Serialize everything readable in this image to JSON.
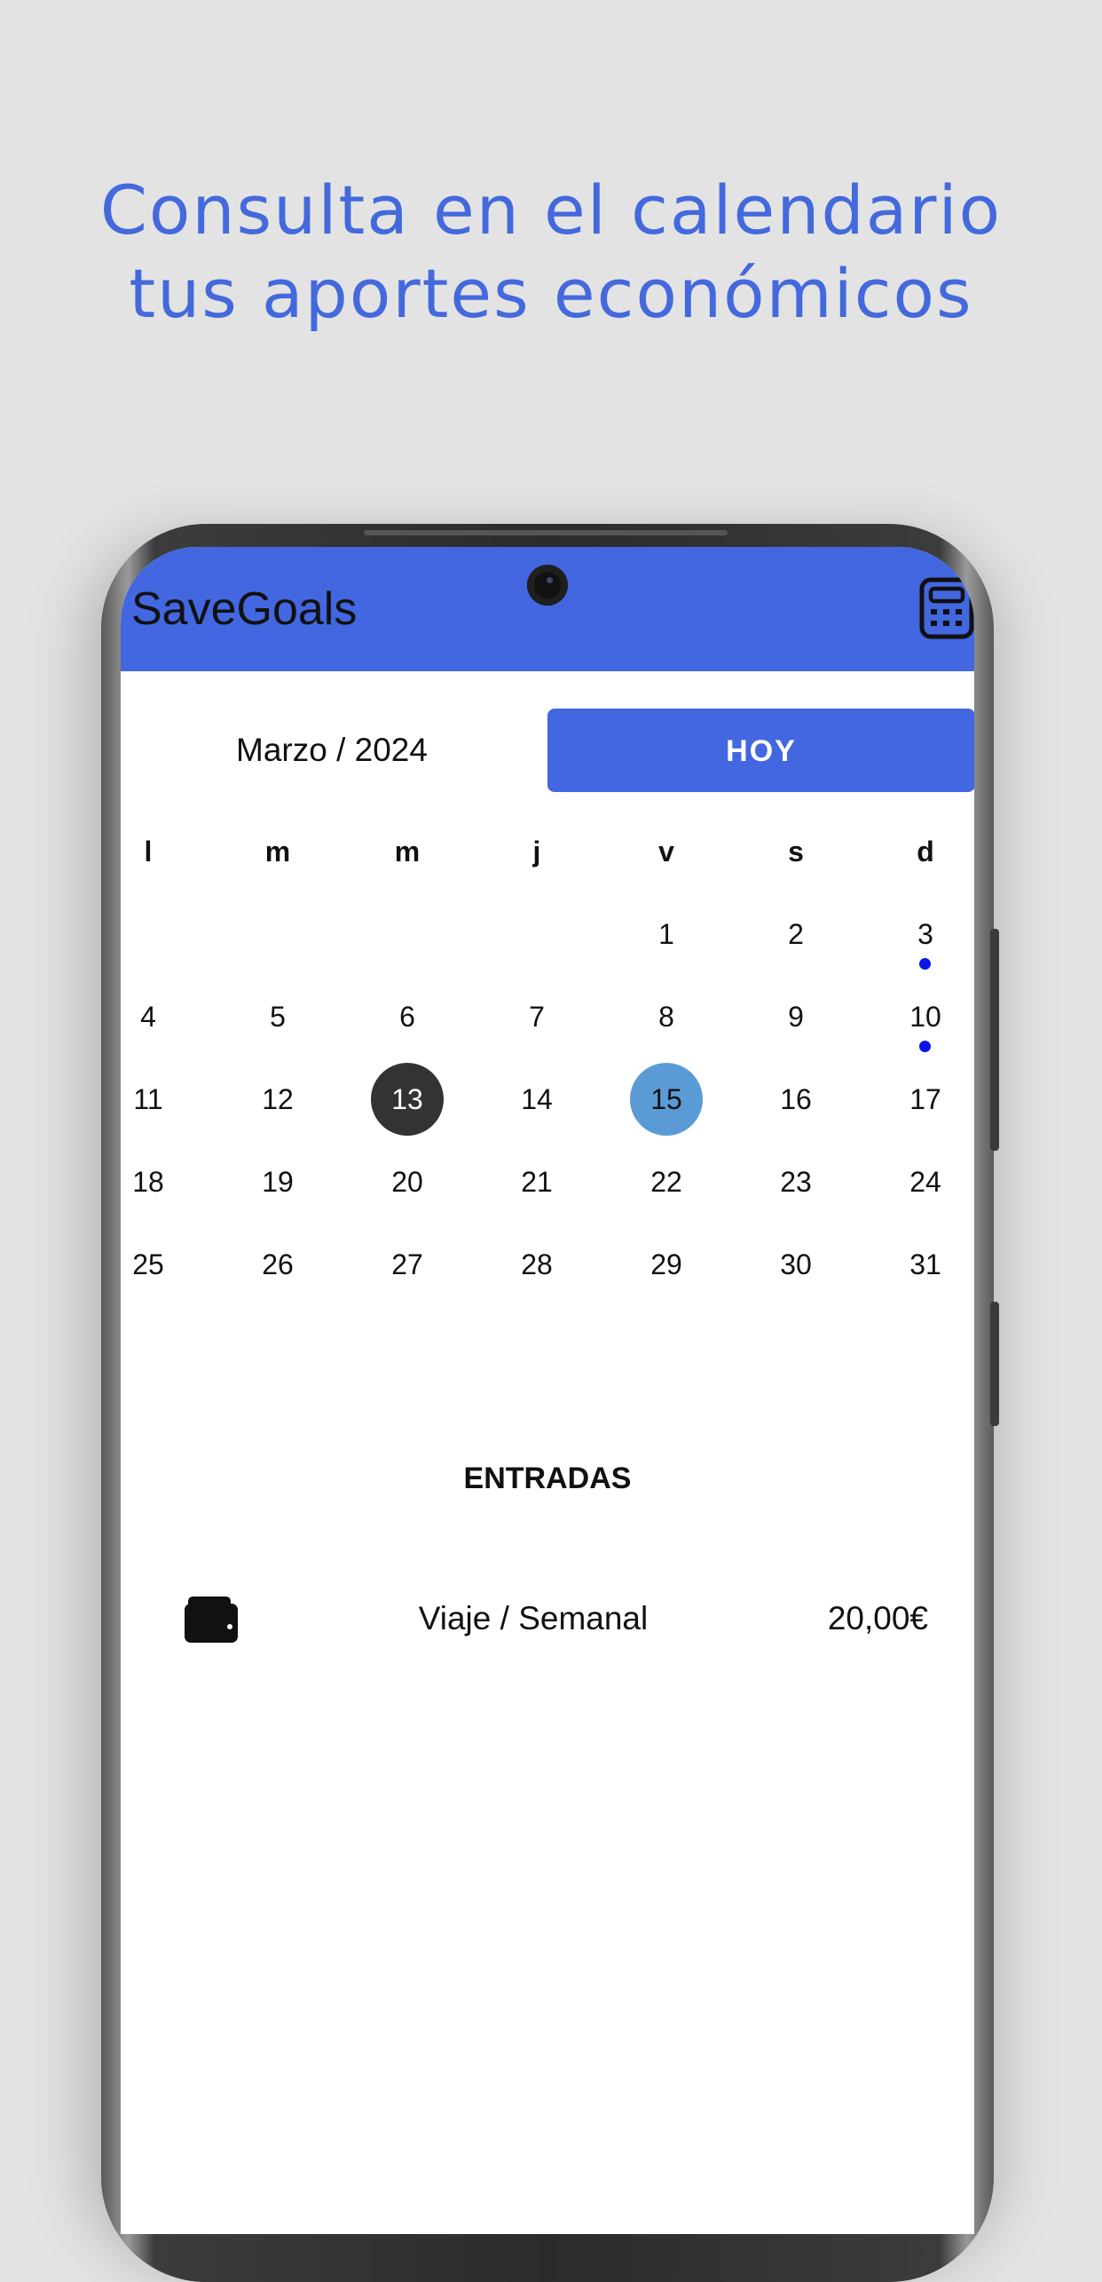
{
  "headline": {
    "line1": "Consulta en el calendario",
    "line2": "tus aportes económicos"
  },
  "colors": {
    "accent": "#4267e0",
    "headline": "#4469dc",
    "selected_day": "#333333",
    "today_day": "#5b9bd5",
    "event_dot": "#0a14e6"
  },
  "appbar": {
    "title": "SaveGoals",
    "action_icon": "calculator-icon"
  },
  "calendar": {
    "month_label": "Marzo / 2024",
    "today_button": "HOY",
    "weekdays": [
      "l",
      "m",
      "m",
      "j",
      "v",
      "s",
      "d"
    ],
    "weeks": [
      [
        "",
        "",
        "",
        "",
        "1",
        "2",
        "3"
      ],
      [
        "4",
        "5",
        "6",
        "7",
        "8",
        "9",
        "10"
      ],
      [
        "11",
        "12",
        "13",
        "14",
        "15",
        "16",
        "17"
      ],
      [
        "18",
        "19",
        "20",
        "21",
        "22",
        "23",
        "24"
      ],
      [
        "25",
        "26",
        "27",
        "28",
        "29",
        "30",
        "31"
      ]
    ],
    "selected_day": "13",
    "today": "15",
    "days_with_entries": [
      "3",
      "10"
    ]
  },
  "entries": {
    "title": "ENTRADAS",
    "items": [
      {
        "icon": "wallet-icon",
        "name": "Viaje / Semanal",
        "amount": "20,00€"
      }
    ]
  }
}
